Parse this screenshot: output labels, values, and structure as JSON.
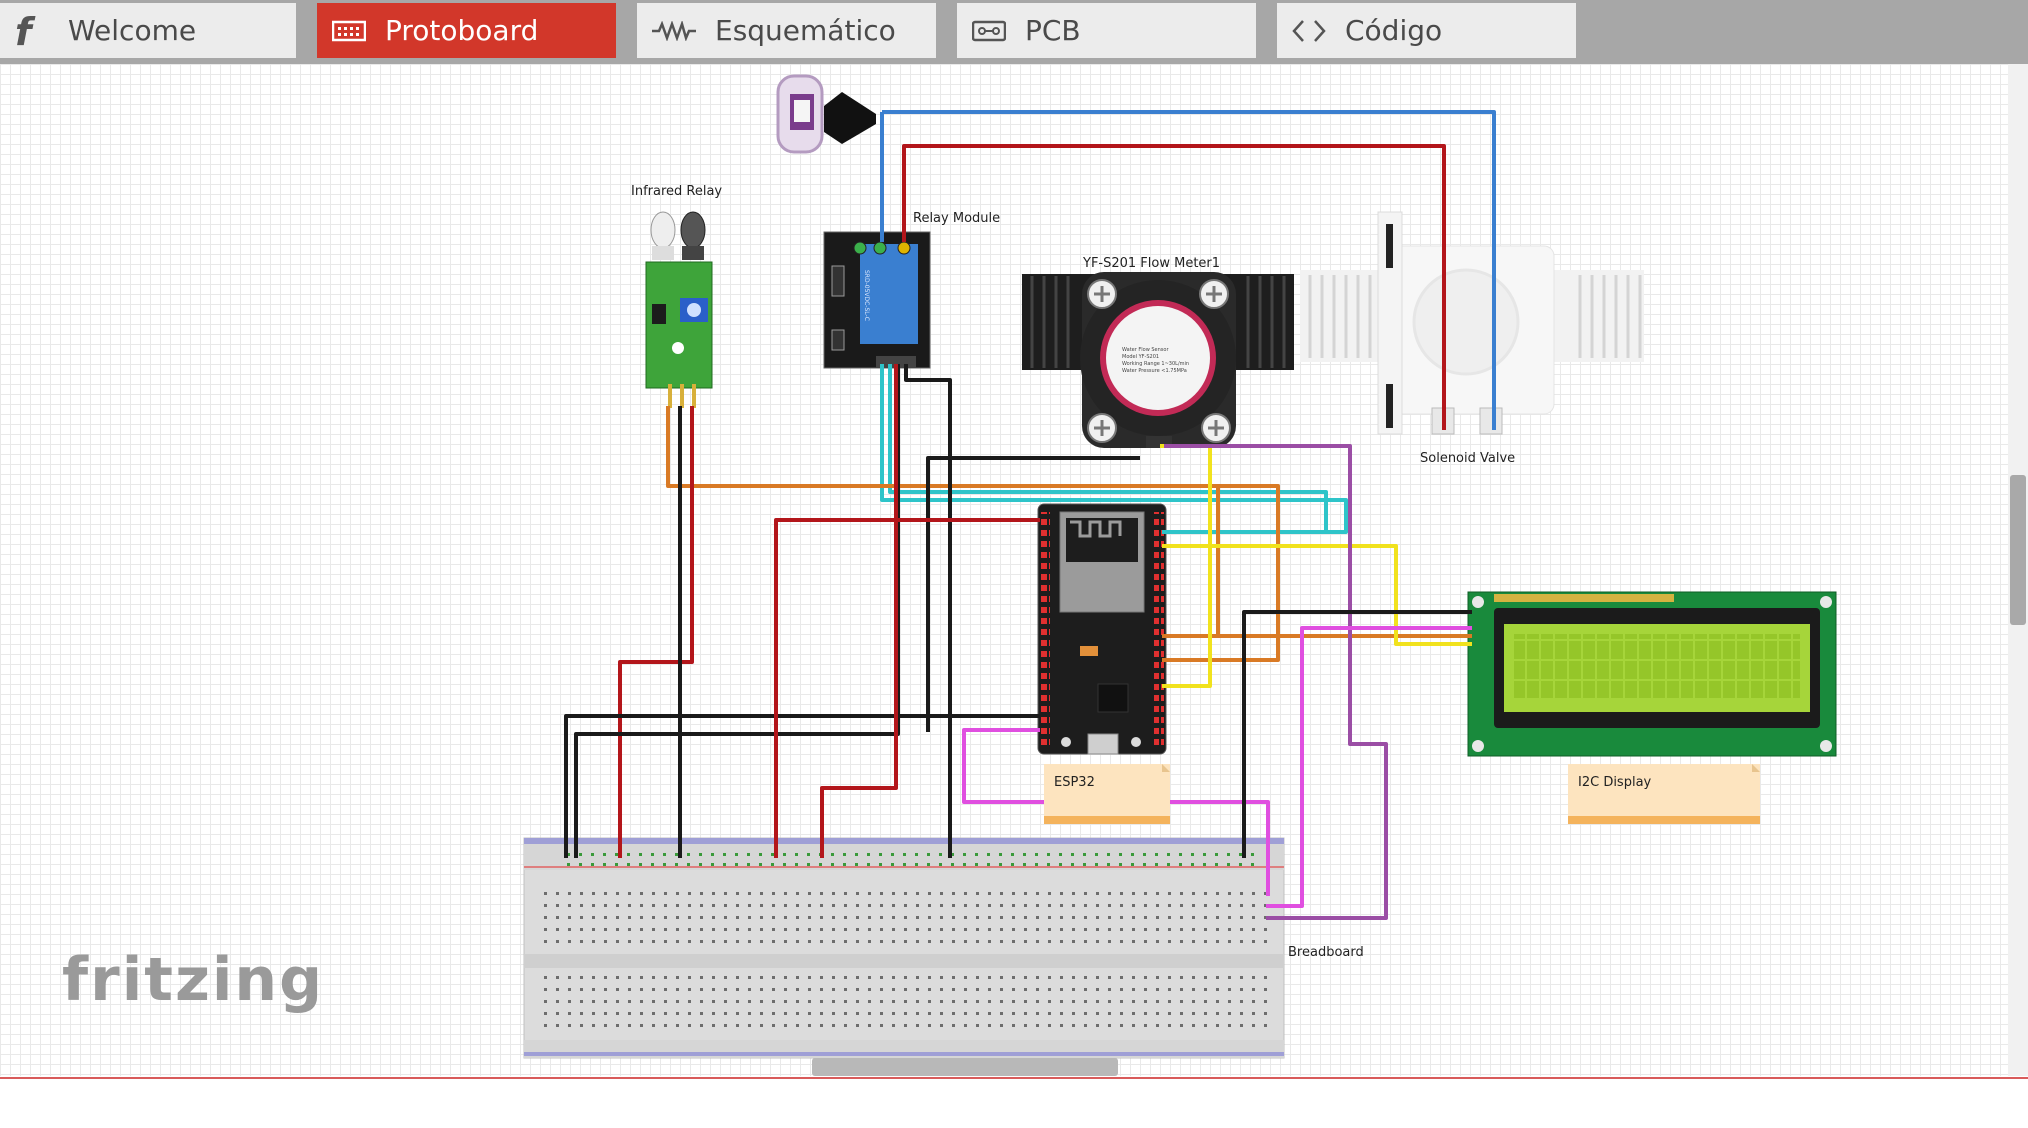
{
  "tabs": [
    {
      "label": "Welcome",
      "icon": "fritzing-f-icon",
      "active": false
    },
    {
      "label": "Protoboard",
      "icon": "breadboard-icon",
      "active": true
    },
    {
      "label": "Esquemático",
      "icon": "schematic-icon",
      "active": false
    },
    {
      "label": "PCB",
      "icon": "pcb-icon",
      "active": false
    },
    {
      "label": "Código",
      "icon": "code-icon",
      "active": false
    }
  ],
  "parts": {
    "infrared_relay": "Infrared Relay",
    "relay_module": "Relay Module",
    "flow_meter": "YF-S201 Flow Meter1",
    "solenoid_valve": "Solenoid Valve",
    "esp32": "ESP32",
    "i2c_display": "I2C Display",
    "breadboard": "Breadboard"
  },
  "brand": {
    "logo_text": "fritzing"
  },
  "colors": {
    "tab_active": "#d2372a",
    "tab_bar": "#a7a7a7",
    "wire_red": "#b3161b",
    "wire_black": "#1a1a1a",
    "wire_blue": "#3a7fd0",
    "wire_cyan": "#2ec4c9",
    "wire_orange": "#d97a25",
    "wire_yellow": "#f1e21d",
    "wire_purple": "#9b4ea5",
    "wire_magenta": "#e04fe0",
    "pcb_green": "#2f8f2f",
    "lcd_screen": "#9fcf2e"
  }
}
